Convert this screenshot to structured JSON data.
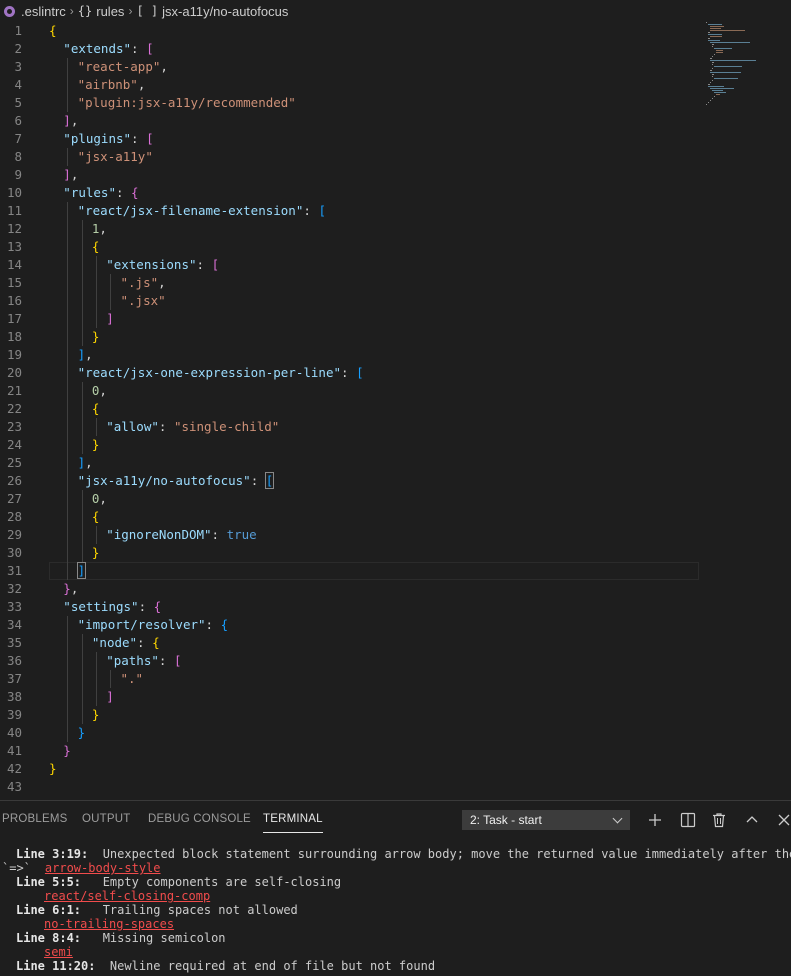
{
  "breadcrumb": {
    "file": ".eslintrc",
    "node1": "rules",
    "node1_symbol": "{}",
    "node2": "jsx-a11y/no-autofocus",
    "node2_symbol": "[ ]"
  },
  "editor": {
    "lines": [
      [
        [
          "b1",
          "{"
        ]
      ],
      [
        [
          "t-key",
          "\"extends\""
        ],
        [
          "t-punc",
          ": "
        ],
        [
          "b2",
          "["
        ]
      ],
      [
        [
          "t-str",
          "\"react-app\""
        ],
        [
          "t-punc",
          ","
        ]
      ],
      [
        [
          "t-str",
          "\"airbnb\""
        ],
        [
          "t-punc",
          ","
        ]
      ],
      [
        [
          "t-str",
          "\"plugin:jsx-a11y/recommended\""
        ]
      ],
      [
        [
          "b2",
          "]"
        ],
        [
          "t-punc",
          ","
        ]
      ],
      [
        [
          "t-key",
          "\"plugins\""
        ],
        [
          "t-punc",
          ": "
        ],
        [
          "b2",
          "["
        ]
      ],
      [
        [
          "t-str",
          "\"jsx-a11y\""
        ]
      ],
      [
        [
          "b2",
          "]"
        ],
        [
          "t-punc",
          ","
        ]
      ],
      [
        [
          "t-key",
          "\"rules\""
        ],
        [
          "t-punc",
          ": "
        ],
        [
          "b2",
          "{"
        ]
      ],
      [
        [
          "t-key",
          "\"react/jsx-filename-extension\""
        ],
        [
          "t-punc",
          ": "
        ],
        [
          "b3",
          "["
        ]
      ],
      [
        [
          "t-num",
          "1"
        ],
        [
          "t-punc",
          ","
        ]
      ],
      [
        [
          "b1",
          "{"
        ]
      ],
      [
        [
          "t-key",
          "\"extensions\""
        ],
        [
          "t-punc",
          ": "
        ],
        [
          "b2",
          "["
        ]
      ],
      [
        [
          "t-str",
          "\".js\""
        ],
        [
          "t-punc",
          ","
        ]
      ],
      [
        [
          "t-str",
          "\".jsx\""
        ]
      ],
      [
        [
          "b2",
          "]"
        ]
      ],
      [
        [
          "b1",
          "}"
        ]
      ],
      [
        [
          "b3",
          "]"
        ],
        [
          "t-punc",
          ","
        ]
      ],
      [
        [
          "t-key",
          "\"react/jsx-one-expression-per-line\""
        ],
        [
          "t-punc",
          ": "
        ],
        [
          "b3",
          "["
        ]
      ],
      [
        [
          "t-num",
          "0"
        ],
        [
          "t-punc",
          ","
        ]
      ],
      [
        [
          "b1",
          "{"
        ]
      ],
      [
        [
          "t-key",
          "\"allow\""
        ],
        [
          "t-punc",
          ": "
        ],
        [
          "t-str",
          "\"single-child\""
        ]
      ],
      [
        [
          "b1",
          "}"
        ]
      ],
      [
        [
          "b3",
          "]"
        ],
        [
          "t-punc",
          ","
        ]
      ],
      [
        [
          "t-key",
          "\"jsx-a11y/no-autofocus\""
        ],
        [
          "t-punc",
          ": "
        ],
        [
          "b3 bracket-match",
          "["
        ]
      ],
      [
        [
          "t-num",
          "0"
        ],
        [
          "t-punc",
          ","
        ]
      ],
      [
        [
          "b1",
          "{"
        ]
      ],
      [
        [
          "t-key",
          "\"ignoreNonDOM\""
        ],
        [
          "t-punc",
          ": "
        ],
        [
          "t-bool",
          "true"
        ]
      ],
      [
        [
          "b1",
          "}"
        ]
      ],
      [
        [
          "b3 bracket-match",
          "]"
        ]
      ],
      [
        [
          "b2",
          "}"
        ],
        [
          "t-punc",
          ","
        ]
      ],
      [
        [
          "t-key",
          "\"settings\""
        ],
        [
          "t-punc",
          ": "
        ],
        [
          "b2",
          "{"
        ]
      ],
      [
        [
          "t-key",
          "\"import/resolver\""
        ],
        [
          "t-punc",
          ": "
        ],
        [
          "b3",
          "{"
        ]
      ],
      [
        [
          "t-key",
          "\"node\""
        ],
        [
          "t-punc",
          ": "
        ],
        [
          "b1",
          "{"
        ]
      ],
      [
        [
          "t-key",
          "\"paths\""
        ],
        [
          "t-punc",
          ": "
        ],
        [
          "b2",
          "["
        ]
      ],
      [
        [
          "t-str",
          "\".\""
        ]
      ],
      [
        [
          "b2",
          "]"
        ]
      ],
      [
        [
          "b1",
          "}"
        ]
      ],
      [
        [
          "b3",
          "}"
        ]
      ],
      [
        [
          "b2",
          "}"
        ]
      ],
      [
        [
          "b1",
          "}"
        ]
      ],
      []
    ],
    "indents": [
      0,
      1,
      2,
      2,
      2,
      1,
      1,
      2,
      1,
      1,
      2,
      3,
      3,
      4,
      5,
      5,
      4,
      3,
      2,
      2,
      3,
      3,
      4,
      3,
      2,
      2,
      3,
      3,
      4,
      3,
      2,
      1,
      1,
      2,
      3,
      4,
      5,
      4,
      3,
      2,
      1,
      0,
      0
    ]
  },
  "panel": {
    "tabs": [
      "PROBLEMS",
      "OUTPUT",
      "DEBUG CONSOLE",
      "TERMINAL"
    ],
    "active_tab": "TERMINAL",
    "task_select": "2: Task - start",
    "terminal_lines": [
      {
        "loc": "Line 3:19:",
        "msg": "  Unexpected block statement surrounding arrow body; move the returned value immediately after the"
      },
      {
        "prefix": "`=>`",
        "rule": "arrow-body-style"
      },
      {
        "loc": "Line 5:5:",
        "msg": "   Empty components are self-closing"
      },
      {
        "rule": "react/self-closing-comp"
      },
      {
        "loc": "Line 6:1:",
        "msg": "   Trailing spaces not allowed"
      },
      {
        "rule": "no-trailing-spaces"
      },
      {
        "loc": "Line 8:4:",
        "msg": "   Missing semicolon"
      },
      {
        "rule": "semi"
      },
      {
        "loc": "Line 11:20:",
        "msg": "  Newline required at end of file but not found"
      }
    ]
  }
}
